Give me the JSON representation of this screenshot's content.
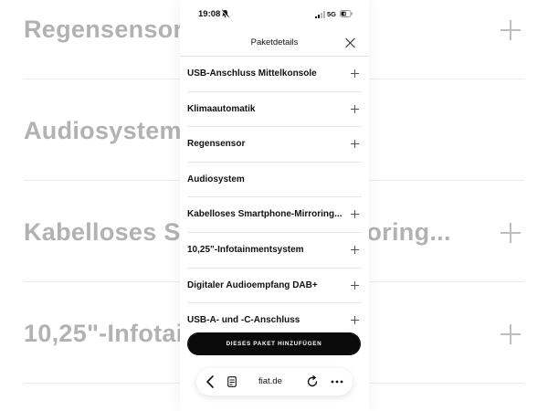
{
  "background": {
    "rows": [
      {
        "label": "Regensensor"
      },
      {
        "label": "Audiosystem"
      },
      {
        "label": "Kabelloses Smartphone-Mirroring..."
      },
      {
        "label": "10,25\"-Infotainmentsystem"
      }
    ]
  },
  "status_bar": {
    "time": "19:08",
    "network": "5G",
    "battery": "43"
  },
  "sheet": {
    "title": "Paketdetails",
    "items": [
      {
        "label": "USB-Anschluss Mittelkonsole",
        "icon": "plus-icon"
      },
      {
        "label": "Klimaautomatik",
        "icon": "plus-icon"
      },
      {
        "label": "Regensensor",
        "icon": "plus-icon"
      },
      {
        "label": "Audiosystem",
        "icon": ""
      },
      {
        "label": "Kabelloses Smartphone-Mirroring...",
        "icon": "plus-icon"
      },
      {
        "label": "10,25\"-Infotainmentsystem",
        "icon": "plus-icon"
      },
      {
        "label": "Digitaler Audioempfang DAB+",
        "icon": "plus-icon"
      },
      {
        "label": "USB-A- und -C-Anschluss",
        "icon": "plus-icon"
      }
    ],
    "cta_label": "DIESES PAKET HINZUFÜGEN"
  },
  "browser": {
    "url": "fiat.de"
  },
  "colors": {
    "cta_background": "#0b0b0b",
    "background_text": "#b2b2b2",
    "divider": "#e6e6e6"
  }
}
